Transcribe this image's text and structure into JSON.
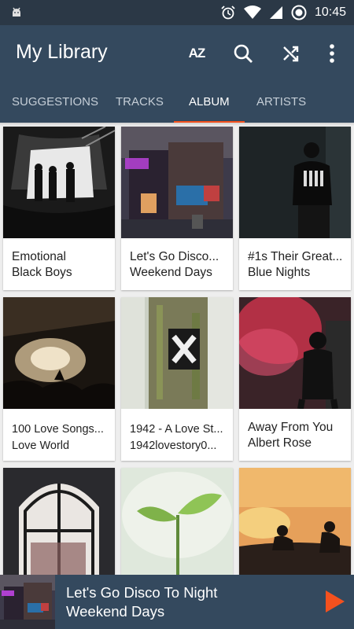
{
  "status_bar": {
    "time": "10:45",
    "icons": [
      "android-icon",
      "alarm-icon",
      "wifi-icon",
      "signal-icon",
      "sync-icon"
    ]
  },
  "app_bar": {
    "title": "My Library",
    "sort_label": "AZ",
    "actions": [
      "sort-az-icon",
      "search-icon",
      "shuffle-icon",
      "more-vert-icon"
    ]
  },
  "tabs": [
    {
      "label": "SUGGESTIONS",
      "active": false
    },
    {
      "label": "TRACKS",
      "active": false
    },
    {
      "label": "ALBUM",
      "active": true
    },
    {
      "label": "ARTISTS",
      "active": false
    }
  ],
  "accent_color": "#f4511e",
  "albums": [
    {
      "title": "Emotional",
      "artist": "Black Boys"
    },
    {
      "title": "Let's Go Disco...",
      "artist": "Weekend Days"
    },
    {
      "title": "#1s Their Great...",
      "artist": "Blue Nights"
    },
    {
      "title": "100 Love Songs...",
      "artist": "Love World"
    },
    {
      "title": "1942 - A Love St...",
      "artist": "1942lovestory0..."
    },
    {
      "title": "Away From You",
      "artist": "Albert Rose"
    },
    {
      "title": "",
      "artist": ""
    },
    {
      "title": "",
      "artist": ""
    },
    {
      "title": "",
      "artist": ""
    }
  ],
  "now_playing": {
    "title": "Let's Go Disco To Night",
    "artist": "Weekend Days"
  }
}
